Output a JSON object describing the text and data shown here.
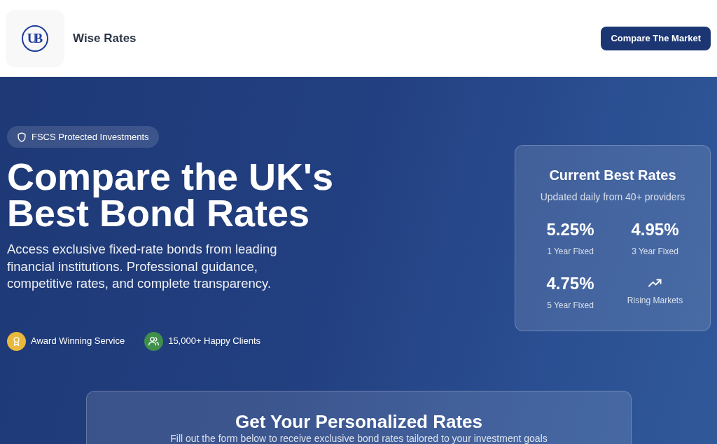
{
  "header": {
    "logo": {
      "monogram": "UB"
    },
    "brand": "Wise Rates",
    "cta": "Compare The Market"
  },
  "hero": {
    "badge": "FSCS Protected Investments",
    "title": "Compare the UK's Best Bond Rates",
    "description": "Access exclusive fixed-rate bonds from leading financial institutions. Professional guidance, competitive rates, and complete transparency.",
    "features": [
      {
        "kind": "award",
        "label": "Award Winning Service",
        "color": "#e8b93c"
      },
      {
        "kind": "clients",
        "label": "15,000+ Happy Clients",
        "color": "#3f8f4b"
      }
    ]
  },
  "rates_card": {
    "title": "Current Best Rates",
    "subtitle": "Updated daily from 40+ providers",
    "items": [
      {
        "kind": "rate",
        "value": "5.25%",
        "label": "1 Year Fixed"
      },
      {
        "kind": "rate",
        "value": "4.95%",
        "label": "3 Year Fixed"
      },
      {
        "kind": "rate",
        "value": "4.75%",
        "label": "5 Year Fixed"
      },
      {
        "kind": "trend",
        "label": "Rising Markets"
      }
    ]
  },
  "form_card": {
    "title": "Get Your Personalized Rates",
    "subtitle": "Fill out the form below to receive exclusive bond rates tailored to your investment goals"
  }
}
